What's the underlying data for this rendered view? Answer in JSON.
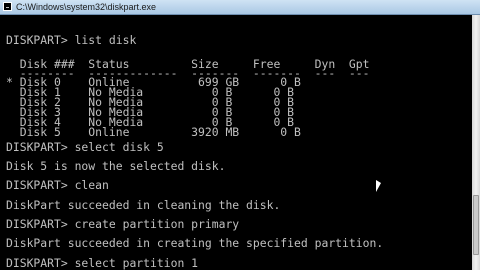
{
  "window": {
    "title": "C:\\Windows\\system32\\diskpart.exe"
  },
  "console": {
    "lines": [
      "DISKPART> list disk",
      "",
      "  Disk ###  Status         Size     Free     Dyn  Gpt",
      "  --------  -------------  -------  -------  ---  ---",
      "* Disk 0    Online          699 GB      0 B",
      "  Disk 1    No Media          0 B      0 B",
      "  Disk 2    No Media          0 B      0 B",
      "  Disk 3    No Media          0 B      0 B",
      "  Disk 4    No Media          0 B      0 B",
      "  Disk 5    Online         3920 MB      0 B",
      "",
      "DISKPART> select disk 5",
      "",
      "Disk 5 is now the selected disk.",
      "",
      "DISKPART> clean",
      "",
      "DiskPart succeeded in cleaning the disk.",
      "",
      "DISKPART> create partition primary",
      "",
      "DiskPart succeeded in creating the specified partition.",
      "",
      "DISKPART> select partition 1"
    ]
  }
}
